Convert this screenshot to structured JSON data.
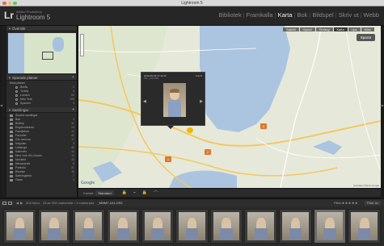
{
  "mac": {
    "title": "Lightroom 5",
    "dot_colors": [
      "#ee5e57",
      "#f5be4f",
      "#63c657"
    ]
  },
  "identity": {
    "logo": "Lr",
    "brand": "Adobe Photoshop",
    "product": "Lightroom 5"
  },
  "modules": [
    {
      "label": "Bibliotek",
      "active": false
    },
    {
      "label": "Framkalla",
      "active": false
    },
    {
      "label": "Karta",
      "active": true
    },
    {
      "label": "Bok",
      "active": false
    },
    {
      "label": "Bildspel",
      "active": false
    },
    {
      "label": "Skriv ut",
      "active": false
    },
    {
      "label": "Webb",
      "active": false
    }
  ],
  "left": {
    "navigator": {
      "title": "Översikt"
    },
    "saved": {
      "title": "Sparade platser",
      "parent": "Mina platser",
      "items": [
        {
          "label": "Borås",
          "count": "2"
        },
        {
          "label": "Torsby",
          "count": "8"
        },
        {
          "label": "London",
          "count": "53"
        },
        {
          "label": "New York",
          "count": "105"
        },
        {
          "label": "Spanien",
          "count": "3"
        }
      ]
    },
    "collections": {
      "title": "Samlingar",
      "items": [
        {
          "label": "Smarta samlingar",
          "count": ""
        },
        {
          "label": "Bok",
          "count": "4"
        },
        {
          "label": "Bröllop",
          "count": "31"
        },
        {
          "label": "Engelsmännen",
          "count": "24"
        },
        {
          "label": "Familjefoto",
          "count": "12"
        },
        {
          "label": "Favoriter",
          "count": "40"
        },
        {
          "label": "Gör-med-tur",
          "count": "17"
        },
        {
          "label": "Inbjudan",
          "count": "3"
        },
        {
          "label": "Lekstuga",
          "count": "45"
        },
        {
          "label": "Kalender",
          "count": "10"
        },
        {
          "label": "New York Of Lövsam",
          "count": "12"
        },
        {
          "label": "Nordiskt",
          "count": "33"
        },
        {
          "label": "Närvarande",
          "count": "8"
        },
        {
          "label": "Portfolio",
          "count": "21"
        },
        {
          "label": "Rörelse",
          "count": "16"
        },
        {
          "label": "Samlingsbild",
          "count": "7"
        },
        {
          "label": "Ösam",
          "count": "4"
        }
      ]
    }
  },
  "map": {
    "modes": [
      "Satellit",
      "Hybrid",
      "Terräng",
      "Karta",
      "Ljus",
      "Mörk"
    ],
    "active_mode": "Karta",
    "saved_button": "Sparat",
    "lock": "Lås",
    "google": "Google",
    "copyright": "Kartdata ©2013 Google",
    "pins": [
      {
        "label": "4",
        "color": "#e0772e"
      },
      {
        "label": "2",
        "color": "#e0772e"
      },
      {
        "label": "",
        "color": "#f0b800"
      },
      {
        "label": "1",
        "color": "#e0772e"
      }
    ],
    "popup": {
      "date": "2013-06-29 17:11:20",
      "count": "4 av 8",
      "subtitle": "DSC_2023.NEF",
      "prev": "◀",
      "next": "▶"
    }
  },
  "toolbar": {
    "map_style_label": "Kartstil:",
    "map_style_value": "Standard",
    "tools": [
      "🔒",
      "⌁",
      "🔒",
      "⌒"
    ]
  },
  "filmbar": {
    "count": "204 foton",
    "selected_info": "19 av 204 markerade / 1 markerade",
    "path": "_MNM7-101.CR2",
    "filter_label": "Filter:",
    "stars": "★★★★★",
    "filter_value": "Filter av"
  },
  "filmstrip": {
    "thumbs": 11,
    "selected_index": 9
  }
}
